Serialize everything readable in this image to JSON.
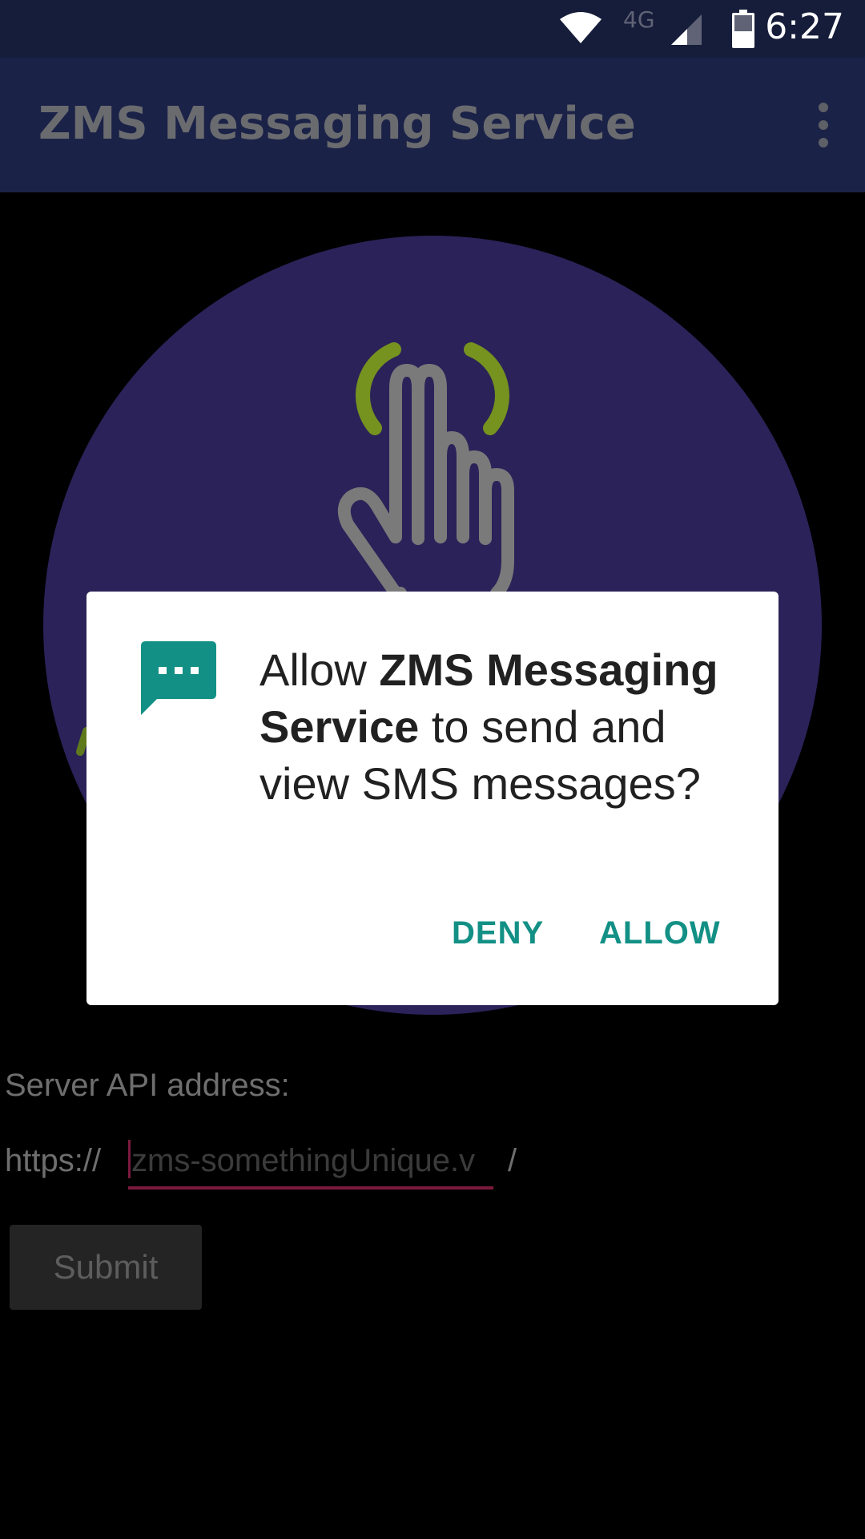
{
  "status_bar": {
    "network_type": "4G",
    "time": "6:27",
    "icons": [
      "wifi-icon",
      "cell-signal-icon",
      "battery-icon"
    ]
  },
  "app_bar": {
    "title": "ZMS Messaging Service",
    "menu_icon": "overflow-menu-icon"
  },
  "hero": {
    "icon": "tap-hand-icon",
    "circle_color": "#2b2259",
    "ring_color": "#76921f",
    "hand_color": "#7a7a7a"
  },
  "form": {
    "server_label": "Server API address:",
    "prefix": "https://",
    "input_placeholder": "zms-somethingUnique.v",
    "suffix": "/",
    "submit_label": "Submit"
  },
  "dialog": {
    "icon": "sms-icon",
    "message_pre": "Allow ",
    "app_name": "ZMS Messaging Service",
    "message_post": " to send and view SMS messages?",
    "deny_label": "DENY",
    "allow_label": "ALLOW",
    "accent_color": "#139085"
  }
}
